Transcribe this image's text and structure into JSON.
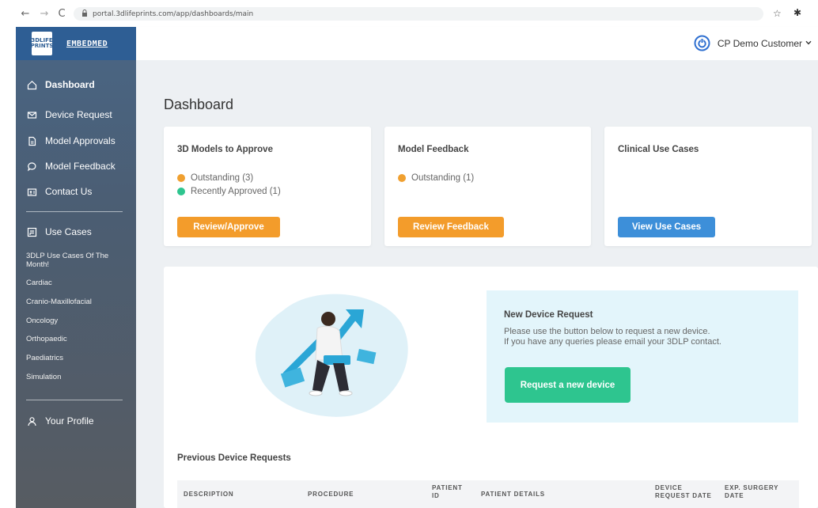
{
  "browser": {
    "back_glyph": "←",
    "forward_glyph": "→",
    "reload_glyph": "C",
    "lock_glyph": "🔒",
    "url": "portal.3dlifeprints.com/app/dashboards/main",
    "star_glyph": "☆",
    "extension_glyph": "✱"
  },
  "brand": {
    "logo_text": "3DLIFE PRINTS",
    "name": "EMBEDMED",
    "color": "#2e5e94"
  },
  "sidebar": {
    "items": [
      {
        "label": "Dashboard",
        "icon": "home-icon"
      },
      {
        "label": "Device Request",
        "icon": "envelope-icon"
      },
      {
        "label": "Model Approvals",
        "icon": "document-icon"
      },
      {
        "label": "Model Feedback",
        "icon": "chat-bubble-icon"
      },
      {
        "label": "Contact Us",
        "icon": "contact-card-icon"
      }
    ],
    "use_cases_label": "Use Cases",
    "use_cases": [
      "3DLP Use Cases Of The Month!",
      "Cardiac",
      "Cranio-Maxillofacial",
      "Oncology",
      "Orthopaedic",
      "Paediatrics",
      "Simulation"
    ],
    "profile_label": "Your Profile"
  },
  "header": {
    "user_name": "CP Demo Customer"
  },
  "page": {
    "title": "Dashboard"
  },
  "cards": [
    {
      "title": "3D Models to Approve",
      "stats": [
        {
          "label": "Outstanding (3)",
          "color": "#f0a030"
        },
        {
          "label": "Recently Approved (1)",
          "color": "#2ec58f"
        }
      ],
      "button": "Review/Approve",
      "button_color": "#f39c2b"
    },
    {
      "title": "Model Feedback",
      "stats": [
        {
          "label": "Outstanding (1)",
          "color": "#f0a030"
        }
      ],
      "button": "Review Feedback",
      "button_color": "#f39c2b"
    },
    {
      "title": "Clinical Use Cases",
      "stats": [],
      "button": "View Use Cases",
      "button_color": "#3d8fd9"
    }
  ],
  "new_request": {
    "title": "New Device Request",
    "text_line1": "Please use the button below to request a new device.",
    "text_line2": "If you have any queries please email your 3DLP contact.",
    "button": "Request a new device"
  },
  "previous": {
    "title": "Previous Device Requests",
    "columns": [
      "DESCRIPTION",
      "PROCEDURE",
      "PATIENT ID",
      "PATIENT DETAILS",
      "DEVICE REQUEST DATE",
      "EXP. SURGERY DATE"
    ]
  }
}
